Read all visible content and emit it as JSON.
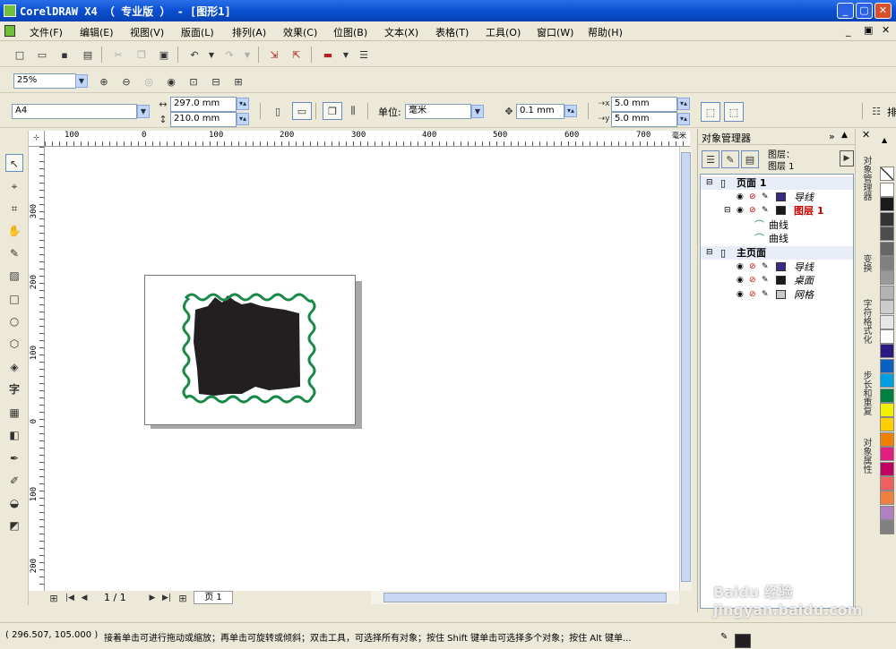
{
  "window": {
    "title": "CorelDRAW X4 （ 专业版 ） - [图形1]"
  },
  "menu": [
    "文件(F)",
    "编辑(E)",
    "视图(V)",
    "版面(L)",
    "排列(A)",
    "效果(C)",
    "位图(B)",
    "文本(X)",
    "表格(T)",
    "工具(O)",
    "窗口(W)",
    "帮助(H)"
  ],
  "zoom": {
    "value": "25%"
  },
  "property_bar": {
    "paper": "A4",
    "width": "297.0 mm",
    "height": "210.0 mm",
    "unit_label": "单位:",
    "unit": "毫米",
    "nudge": "0.1 mm",
    "dup_x": "5.0 mm",
    "dup_y": "5.0 mm"
  },
  "ruler": {
    "top_ticks": [
      "100",
      "0",
      "100",
      "200",
      "300",
      "400",
      "500",
      "600",
      "700",
      "毫米"
    ],
    "left_ticks": [
      "300",
      "200",
      "100",
      "0",
      "100",
      "200"
    ]
  },
  "pager": {
    "pos": "1 / 1",
    "tab": "页 1"
  },
  "docker": {
    "title": "对象管理器",
    "layer_title": "图层：",
    "layer_name": "图层 1",
    "tree": [
      {
        "type": "sec",
        "label": "页面 1"
      },
      {
        "type": "layer",
        "label": "导线",
        "color": "#3a2a80",
        "style": "italic"
      },
      {
        "type": "layer",
        "label": "图层 1",
        "color": "#1a1a1a",
        "style": "red"
      },
      {
        "type": "obj",
        "label": "曲线"
      },
      {
        "type": "obj",
        "label": "曲线"
      },
      {
        "type": "sec",
        "label": "主页面"
      },
      {
        "type": "layer",
        "label": "导线",
        "color": "#3a2a80",
        "style": "italic"
      },
      {
        "type": "layer",
        "label": "桌面",
        "color": "#1a1a1a",
        "style": "italic"
      },
      {
        "type": "layer",
        "label": "网格",
        "color": "#c8c8c8",
        "style": "italic"
      }
    ]
  },
  "side_tabs": [
    "对象管理器",
    "变换",
    "字符格式化",
    "步长和重复",
    "对象属性"
  ],
  "palette": [
    "#ffffff",
    "#1a1a1a",
    "#333333",
    "#4d4d4d",
    "#666666",
    "#808080",
    "#999999",
    "#b3b3b3",
    "#cccccc",
    "#e6e6e6",
    "#ffffff",
    "#2a1a80",
    "#0a5fc0",
    "#00a0e0",
    "#008040",
    "#f0f000",
    "#ffd000",
    "#f08000",
    "#e02080",
    "#c00060",
    "#f06060",
    "#f08040",
    "#b080c0",
    "#808080"
  ],
  "status": {
    "coords": "( 296.507, 105.000 )",
    "hint": "接着单击可进行拖动或缩放；再单击可旋转或倾斜；双击工具，可选择所有对象；按住 Shift 键单击可选择多个对象；按住 Alt 键单..."
  },
  "watermark": "Baidu 经验 jingyan.baidu.com",
  "toolbar_cut_label": "排"
}
